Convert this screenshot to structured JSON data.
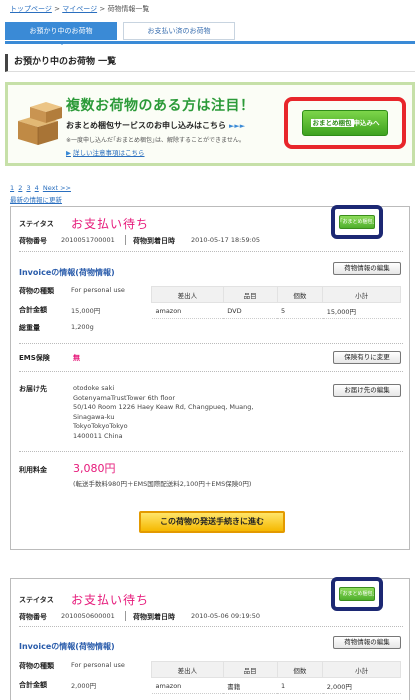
{
  "breadcrumb": {
    "items": [
      "トップページ",
      "マイページ",
      "荷物情報一覧"
    ],
    "sep": ">"
  },
  "tabs": [
    {
      "label": "お預かり中のお荷物",
      "active": true
    },
    {
      "label": "お支払い済のお荷物",
      "active": false
    }
  ],
  "page_title": "お預かり中のお荷物 一覧",
  "banner": {
    "headline": "複数お荷物のある方は注目！",
    "subline": "おまとめ梱包サービスのお申し込みはこちら",
    "subline_arrows": "►►►",
    "note": "※一度申し込んだ｢おまとめ梱包｣は、解除することができません。",
    "link": "詳しい注意事項はこちら",
    "button_inner": "おまとめ梱包",
    "button_suffix": "申込みへ"
  },
  "pager": {
    "pages": [
      "1",
      "2",
      "3",
      "4"
    ],
    "next": "Next >>"
  },
  "refresh": "最新の情報に更新",
  "cards": [
    {
      "status_label": "ステイタス",
      "status": "お支払い待ち",
      "bundle_badge": "｢おまとめ梱包｣可",
      "number_label": "荷物番号",
      "number": "2010051700001",
      "arrival_label": "荷物到着日時",
      "arrival": "2010-05-17 18:59:05",
      "invoice_head": "Invoiceの情報(荷物情報)",
      "invoice_edit": "荷物情報の編集",
      "type_label": "荷物の種類",
      "type": "For personal use",
      "total_label": "合計金額",
      "total": "15,000円",
      "weight_label": "総重量",
      "weight": "1,200g",
      "table_headers": [
        "差出人",
        "品目",
        "個数",
        "小計"
      ],
      "rows": [
        [
          "amazon",
          "DVD",
          "5",
          "15,000円"
        ]
      ],
      "ems_label": "EMS保険",
      "ems_value": "無",
      "ems_btn": "保険有りに変更",
      "dest_label": "お届け先",
      "dest_btn": "お届け先の編集",
      "address": [
        "otodoke saki",
        "GotenyamaTrustTower 6th floor",
        "50/140 Room 1226 Haey Keaw Rd, Changpueq, Muang,",
        "Sinagawa-ku",
        "TokyoTokyoTokyo",
        "1400011     China"
      ],
      "fee_label": "利用料金",
      "fee": "3,080円",
      "fee_note": "(転送手数料980円＋EMS国際配送料2,100円＋EMS保険0円)",
      "proceed_btn": "この荷物の発送手続きに進む"
    },
    {
      "status_label": "ステイタス",
      "status": "お支払い待ち",
      "bundle_badge": "｢おまとめ梱包｣可",
      "number_label": "荷物番号",
      "number": "2010050600001",
      "arrival_label": "荷物到着日時",
      "arrival": "2010-05-06 09:19:50",
      "invoice_head": "Invoiceの情報(荷物情報)",
      "invoice_edit": "荷物情報の編集",
      "type_label": "荷物の種類",
      "type": "For personal use",
      "total_label": "合計金額",
      "total": "2,000円",
      "table_headers": [
        "差出人",
        "品目",
        "個数",
        "小計"
      ],
      "rows": [
        [
          "amazon",
          "書籍",
          "1",
          "2,000円"
        ]
      ]
    }
  ],
  "colors": {
    "accent": "#3a8ad6",
    "status": "#e6197a",
    "ring_red": "#e8262b",
    "ring_navy": "#1c2873",
    "banner_green": "#2b9a38"
  }
}
